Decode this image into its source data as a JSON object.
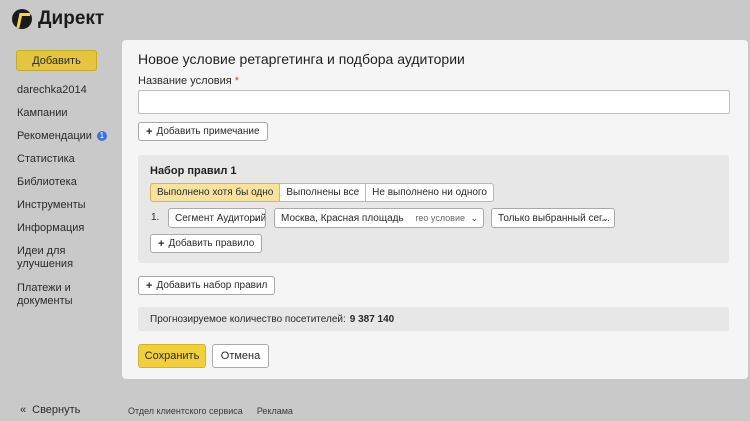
{
  "app": {
    "title": "Директ",
    "logo_icon": "yandex-direct-logo-icon"
  },
  "sidebar": {
    "add_button": "Добавить",
    "items": [
      {
        "label": "darechka2014"
      },
      {
        "label": "Кампании"
      },
      {
        "label": "Рекомендации",
        "badge": "1"
      },
      {
        "label": "Статистика"
      },
      {
        "label": "Библиотека"
      },
      {
        "label": "Инструменты"
      },
      {
        "label": "Информация"
      },
      {
        "label": "Идеи для улучшения"
      },
      {
        "label": "Платежи и документы"
      }
    ],
    "collapse_label": "Свернуть",
    "collapse_icon": "«"
  },
  "form": {
    "title": "Новое условие ретаргетинга и подбора аудитории",
    "name_label": "Название условия",
    "required_mark": "*",
    "name_value": "",
    "add_note_button": "Добавить примечание",
    "plus": "+",
    "ruleset": {
      "title": "Набор правил 1",
      "modes": [
        "Выполнено хотя бы одно",
        "Выполнены все",
        "Не выполнено ни одного"
      ],
      "active_mode": 0,
      "rule": {
        "number": "1.",
        "type": "Сегмент Аудиторий",
        "segment": "Москва, Красная площадь",
        "segment_hint": "гео условие",
        "filter": "Только выбранный сег..."
      },
      "add_rule_button": "Добавить правило"
    },
    "add_ruleset_button": "Добавить набор правил",
    "forecast_label": "Прогнозируемое количество посетителей:",
    "forecast_value": "9 387 140",
    "save_button": "Сохранить",
    "cancel_button": "Отмена"
  },
  "footer": {
    "links": [
      "Отдел клиентского сервиса",
      "Реклама"
    ]
  },
  "colors": {
    "accent": "#f1cf3e",
    "background": "#c9c9c9",
    "panel": "#f5f5f5",
    "required": "#e5461f",
    "badge": "#3b74d8"
  }
}
